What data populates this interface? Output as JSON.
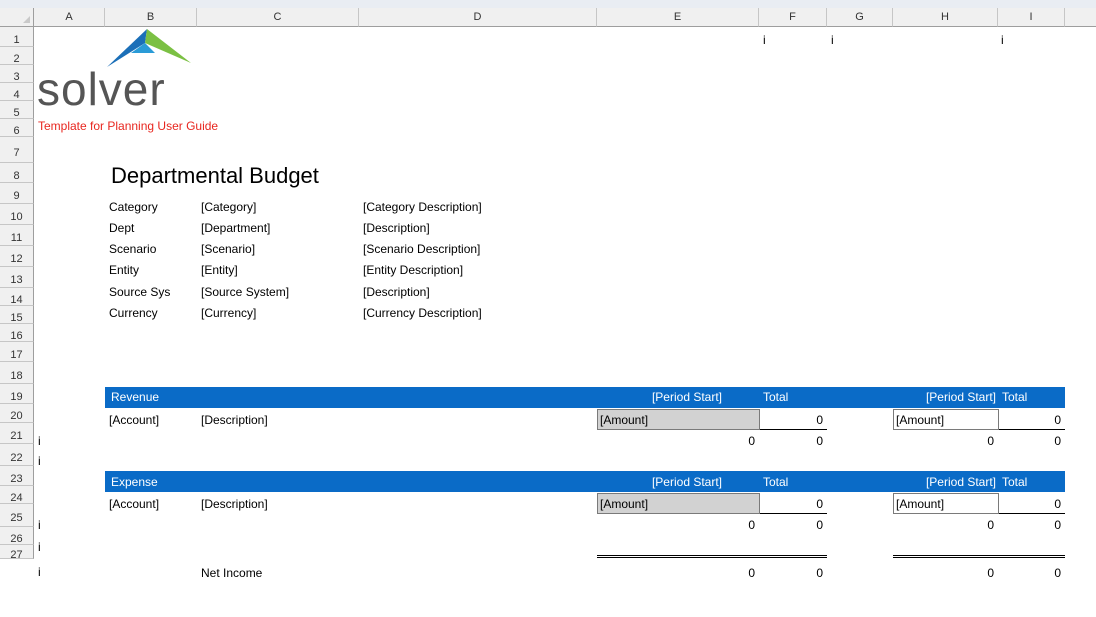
{
  "columns": [
    "A",
    "B",
    "C",
    "D",
    "E",
    "F",
    "G",
    "H",
    "I"
  ],
  "rows": [
    "1",
    "2",
    "3",
    "4",
    "5",
    "6",
    "7",
    "8",
    "9",
    "10",
    "11",
    "12",
    "13",
    "14",
    "15",
    "16",
    "17",
    "18",
    "19",
    "20",
    "21",
    "22",
    "23",
    "24",
    "25",
    "26",
    "27"
  ],
  "logo": {
    "text": "solver",
    "colors": [
      "#1b6fb8",
      "#7bc043"
    ]
  },
  "subtitle": "Template for Planning User Guide",
  "markers": {
    "row1_f": "i",
    "row1_g": "i",
    "row1_i": "i",
    "row19": "i",
    "row20": "i",
    "row23": "i",
    "row24": "i",
    "row25": "i"
  },
  "title": "Departmental Budget",
  "header_fields": [
    {
      "label": "Category",
      "value": "[Category]",
      "desc": "[Category Description]"
    },
    {
      "label": "Dept",
      "value": "[Department]",
      "desc": "[Description]"
    },
    {
      "label": "Scenario",
      "value": "[Scenario]",
      "desc": "[Scenario Description]"
    },
    {
      "label": "Entity",
      "value": "[Entity]",
      "desc": "[Entity Description]"
    },
    {
      "label": "Source Sys",
      "value": "[Source System]",
      "desc": "[Description]"
    },
    {
      "label": "Currency",
      "value": "[Currency]",
      "desc": "[Currency Description]"
    }
  ],
  "revenue": {
    "heading": "Revenue",
    "period1": "[Period Start]",
    "total1": "Total",
    "period2": "[Period Start]",
    "total2": "Total",
    "account": "[Account]",
    "description": "[Description]",
    "amount1": "[Amount]",
    "value1": "0",
    "amount2": "[Amount]",
    "value2": "0",
    "sub_e": "0",
    "sub_f": "0",
    "sub_h": "0",
    "sub_i": "0"
  },
  "expense": {
    "heading": "Expense",
    "period1": "[Period Start]",
    "total1": "Total",
    "period2": "[Period Start]",
    "total2": "Total",
    "account": "[Account]",
    "description": "[Description]",
    "amount1": "[Amount]",
    "value1": "0",
    "amount2": "[Amount]",
    "value2": "0",
    "sub_e": "0",
    "sub_f": "0",
    "sub_h": "0",
    "sub_i": "0"
  },
  "net_income": {
    "label": "Net Income",
    "e": "0",
    "f": "0",
    "h": "0",
    "i": "0"
  },
  "colors": {
    "band": "#0a6bc7",
    "subtitle": "#e8261f",
    "amount_fill": "#d2d2d2"
  }
}
